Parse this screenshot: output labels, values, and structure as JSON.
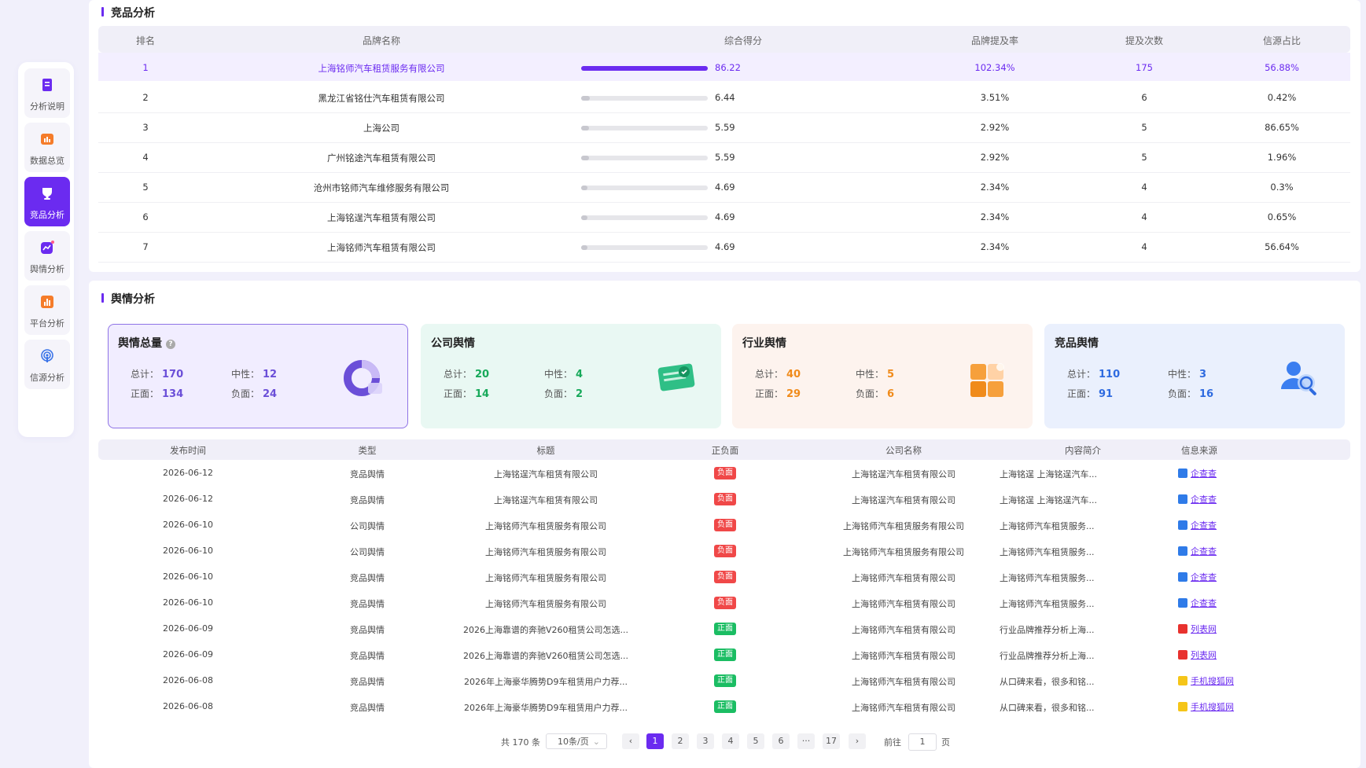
{
  "sidebar": {
    "items": [
      {
        "label": "分析说明",
        "icon": "document-icon",
        "active": false
      },
      {
        "label": "数据总览",
        "icon": "bar-chart-icon",
        "active": false
      },
      {
        "label": "竞品分析",
        "icon": "trophy-icon",
        "active": true
      },
      {
        "label": "舆情分析",
        "icon": "trend-icon",
        "active": false
      },
      {
        "label": "平台分析",
        "icon": "platform-chart-icon",
        "active": false
      },
      {
        "label": "信源分析",
        "icon": "broadcast-icon",
        "active": false
      }
    ]
  },
  "competitor": {
    "title": "竞品分析",
    "headers": {
      "rank": "排名",
      "brand": "品牌名称",
      "score": "综合得分",
      "rate": "品牌提及率",
      "count": "提及次数",
      "share": "信源占比"
    },
    "rows": [
      {
        "rank": "1",
        "brand": "上海铭师汽车租赁服务有限公司",
        "score": "86.22",
        "score_pct": 100,
        "rate": "102.34%",
        "count": "175",
        "share": "56.88%"
      },
      {
        "rank": "2",
        "brand": "黑龙江省铭仕汽车租赁有限公司",
        "score": "6.44",
        "score_pct": 7,
        "rate": "3.51%",
        "count": "6",
        "share": "0.42%"
      },
      {
        "rank": "3",
        "brand": "上海公司",
        "score": "5.59",
        "score_pct": 6,
        "rate": "2.92%",
        "count": "5",
        "share": "86.65%"
      },
      {
        "rank": "4",
        "brand": "广州铭途汽车租赁有限公司",
        "score": "5.59",
        "score_pct": 6,
        "rate": "2.92%",
        "count": "5",
        "share": "1.96%"
      },
      {
        "rank": "5",
        "brand": "沧州市铭师汽车维修服务有限公司",
        "score": "4.69",
        "score_pct": 5,
        "rate": "2.34%",
        "count": "4",
        "share": "0.3%"
      },
      {
        "rank": "6",
        "brand": "上海铭逞汽车租赁有限公司",
        "score": "4.69",
        "score_pct": 5,
        "rate": "2.34%",
        "count": "4",
        "share": "0.65%"
      },
      {
        "rank": "7",
        "brand": "上海铭师汽车租赁有限公司",
        "score": "4.69",
        "score_pct": 5,
        "rate": "2.34%",
        "count": "4",
        "share": "56.64%"
      }
    ]
  },
  "sentiment": {
    "title": "舆情分析",
    "labels": {
      "total": "总计：",
      "neutral": "中性：",
      "positive": "正面：",
      "negative": "负面："
    },
    "cards": [
      {
        "title": "舆情总量",
        "total": "170",
        "neutral": "12",
        "positive": "134",
        "negative": "24",
        "value_color": "#6b4fd8",
        "bg": "#f1edff",
        "border": "#8f73e6",
        "icon": "donut-chart-icon",
        "help_icon": "question-icon"
      },
      {
        "title": "公司舆情",
        "total": "20",
        "neutral": "4",
        "positive": "14",
        "negative": "2",
        "value_color": "#17a95a",
        "bg": "#e9f8f3",
        "border": "#e9f8f3",
        "icon": "certificate-icon"
      },
      {
        "title": "行业舆情",
        "total": "40",
        "neutral": "5",
        "positive": "29",
        "negative": "6",
        "value_color": "#f08b1b",
        "bg": "#fdf3ee",
        "border": "#fdf3ee",
        "icon": "blocks-icon"
      },
      {
        "title": "竞品舆情",
        "total": "110",
        "neutral": "3",
        "positive": "91",
        "negative": "16",
        "value_color": "#2f6be0",
        "bg": "#eaf0fd",
        "border": "#eaf0fd",
        "icon": "user-search-icon"
      }
    ],
    "table": {
      "headers": {
        "date": "发布时间",
        "type": "类型",
        "title": "标题",
        "polarity": "正负面",
        "company": "公司名称",
        "summary": "内容简介",
        "source": "信息来源"
      },
      "rows": [
        {
          "date": "2026-06-12",
          "type": "竞品舆情",
          "title": "上海铭逞汽车租赁有限公司",
          "polarity": "负面",
          "pol": "neg",
          "company": "上海铭逞汽车租赁有限公司",
          "summary": "上海铭逞 上海铭逞汽车...",
          "source": "企查查",
          "src_icon": "qichacha-icon",
          "src_color": "#2f7be8"
        },
        {
          "date": "2026-06-12",
          "type": "竞品舆情",
          "title": "上海铭逞汽车租赁有限公司",
          "polarity": "负面",
          "pol": "neg",
          "company": "上海铭逞汽车租赁有限公司",
          "summary": "上海铭逞 上海铭逞汽车...",
          "source": "企查查",
          "src_icon": "qichacha-icon",
          "src_color": "#2f7be8"
        },
        {
          "date": "2026-06-10",
          "type": "公司舆情",
          "title": "上海铭师汽车租赁服务有限公司",
          "polarity": "负面",
          "pol": "neg",
          "company": "上海铭师汽车租赁服务有限公司",
          "summary": "上海铭师汽车租赁服务...",
          "source": "企查查",
          "src_icon": "qichacha-icon",
          "src_color": "#2f7be8"
        },
        {
          "date": "2026-06-10",
          "type": "公司舆情",
          "title": "上海铭师汽车租赁服务有限公司",
          "polarity": "负面",
          "pol": "neg",
          "company": "上海铭师汽车租赁服务有限公司",
          "summary": "上海铭师汽车租赁服务...",
          "source": "企查查",
          "src_icon": "qichacha-icon",
          "src_color": "#2f7be8"
        },
        {
          "date": "2026-06-10",
          "type": "竞品舆情",
          "title": "上海铭师汽车租赁服务有限公司",
          "polarity": "负面",
          "pol": "neg",
          "company": "上海铭师汽车租赁有限公司",
          "summary": "上海铭师汽车租赁服务...",
          "source": "企查查",
          "src_icon": "qichacha-icon",
          "src_color": "#2f7be8"
        },
        {
          "date": "2026-06-10",
          "type": "竞品舆情",
          "title": "上海铭师汽车租赁服务有限公司",
          "polarity": "负面",
          "pol": "neg",
          "company": "上海铭师汽车租赁有限公司",
          "summary": "上海铭师汽车租赁服务...",
          "source": "企查查",
          "src_icon": "qichacha-icon",
          "src_color": "#2f7be8"
        },
        {
          "date": "2026-06-09",
          "type": "竞品舆情",
          "title": "2026上海靠谱的奔驰V260租赁公司怎选...",
          "polarity": "正面",
          "pol": "pos",
          "company": "上海铭师汽车租赁有限公司",
          "summary": "行业品牌推荐分析上海...",
          "source": "列表网",
          "src_icon": "liebiao-icon",
          "src_color": "#e8322e"
        },
        {
          "date": "2026-06-09",
          "type": "竞品舆情",
          "title": "2026上海靠谱的奔驰V260租赁公司怎选...",
          "polarity": "正面",
          "pol": "pos",
          "company": "上海铭师汽车租赁有限公司",
          "summary": "行业品牌推荐分析上海...",
          "source": "列表网",
          "src_icon": "liebiao-icon",
          "src_color": "#e8322e"
        },
        {
          "date": "2026-06-08",
          "type": "竞品舆情",
          "title": "2026年上海豪华腾势D9车租赁用户力荐...",
          "polarity": "正面",
          "pol": "pos",
          "company": "上海铭师汽车租赁有限公司",
          "summary": "从口碑来看，很多和铭...",
          "source": "手机搜狐网",
          "src_icon": "sohu-icon",
          "src_color": "#f5c518"
        },
        {
          "date": "2026-06-08",
          "type": "竞品舆情",
          "title": "2026年上海豪华腾势D9车租赁用户力荐...",
          "polarity": "正面",
          "pol": "pos",
          "company": "上海铭师汽车租赁有限公司",
          "summary": "从口碑来看，很多和铭...",
          "source": "手机搜狐网",
          "src_icon": "sohu-icon",
          "src_color": "#f5c518"
        }
      ]
    },
    "pagination": {
      "total_text": "共 170 条",
      "page_size": "10条/页",
      "pages": [
        "1",
        "2",
        "3",
        "4",
        "5",
        "6",
        "···",
        "17"
      ],
      "current": "1",
      "goto_label": "前往",
      "goto_value": "1",
      "page_unit": "页"
    }
  },
  "colors": {
    "accent": "#6b2bf0",
    "negative": "#f04848",
    "positive": "#1bbd63"
  }
}
